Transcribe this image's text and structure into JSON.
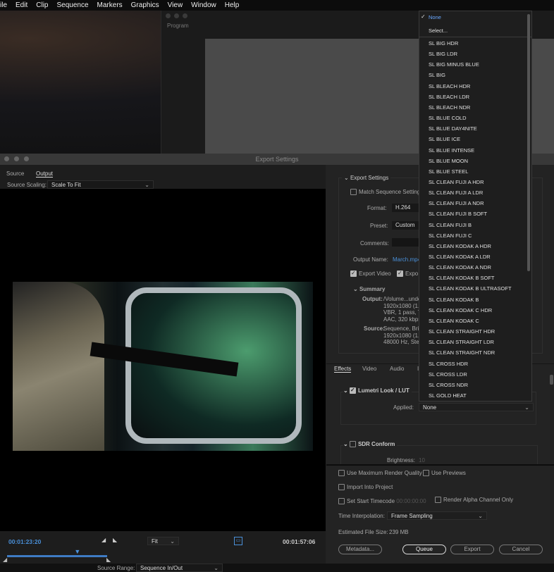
{
  "menu": [
    "ile",
    "Edit",
    "Clip",
    "Sequence",
    "Markers",
    "Graphics",
    "View",
    "Window",
    "Help"
  ],
  "program_label": "Program",
  "window_title": "Export Settings",
  "left": {
    "tabs": [
      "Source",
      "Output"
    ],
    "source_scaling_label": "Source Scaling:",
    "source_scaling_value": "Scale To Fit",
    "current_time": "00:01:23:20",
    "zoom_value": "Fit",
    "duration": "00:01:57:06",
    "source_range_label": "Source Range:",
    "source_range_value": "Sequence In/Out",
    "playhead_fraction": 0.7
  },
  "export_settings": {
    "header": "Export Settings",
    "match_sequence": "Match Sequence Settings",
    "format_label": "Format:",
    "format_value": "H.264",
    "preset_label": "Preset:",
    "preset_value": "Custom",
    "comments_label": "Comments:",
    "output_name_label": "Output Name:",
    "output_name_value": "March.mp4",
    "export_video": "Export Video",
    "export_audio": "Expo",
    "summary": "Summary",
    "output_label": "Output:",
    "output_lines": [
      "/Volume...unde",
      "1920x1080 (1.0",
      "VBR, 1 pass, Ta",
      "AAC, 320 kbps,"
    ],
    "source_label": "Source:",
    "source_lines": [
      "Sequence, Bria",
      "1920x1080 (1.0",
      "48000 Hz, Ster"
    ]
  },
  "effects": {
    "tabs": [
      "Effects",
      "Video",
      "Audio",
      "I"
    ],
    "lumetri": "Lumetri Look / LUT",
    "applied_label": "Applied:",
    "applied_value": "None",
    "sdr": "SDR Conform",
    "brightness_label": "Brightness:",
    "brightness_value": "10"
  },
  "bottom": {
    "max_quality": "Use Maximum Render Quality",
    "use_previews": "Use Previews",
    "import_project": "Import Into Project",
    "start_tc": "Set Start Timecode",
    "start_tc_value": "00:00:00:00",
    "alpha": "Render Alpha Channel Only",
    "time_interp_label": "Time Interpolation:",
    "time_interp_value": "Frame Sampling",
    "file_size_label": "Estimated File Size:",
    "file_size_value": "239 MB",
    "metadata": "Metadata...",
    "queue": "Queue",
    "export": "Export",
    "cancel": "Cancel"
  },
  "dropdown": {
    "selected": "None",
    "select": "Select...",
    "items": [
      "SL BIG HDR",
      "SL BIG LDR",
      "SL BIG MINUS BLUE",
      "SL BIG",
      "SL BLEACH HDR",
      "SL BLEACH LDR",
      "SL BLEACH NDR",
      "SL BLUE COLD",
      "SL BLUE DAY4NITE",
      "SL BLUE ICE",
      "SL BLUE INTENSE",
      "SL BLUE MOON",
      "SL BLUE STEEL",
      "SL CLEAN FUJI A HDR",
      "SL CLEAN FUJI A LDR",
      "SL CLEAN FUJI A NDR",
      "SL CLEAN FUJI B SOFT",
      "SL CLEAN FUJI B",
      "SL CLEAN FUJI C",
      "SL CLEAN KODAK A HDR",
      "SL CLEAN KODAK A LDR",
      "SL CLEAN KODAK A NDR",
      "SL CLEAN KODAK B SOFT",
      "SL CLEAN KODAK B ULTRASOFT",
      "SL CLEAN KODAK B",
      "SL CLEAN KODAK C HDR",
      "SL CLEAN KODAK C",
      "SL CLEAN STRAIGHT HDR",
      "SL CLEAN STRAIGHT LDR",
      "SL CLEAN STRAIGHT NDR",
      "SL CROSS HDR",
      "SL CROSS LDR",
      "SL CROSS NDR",
      "SL GOLD HEAT"
    ]
  }
}
